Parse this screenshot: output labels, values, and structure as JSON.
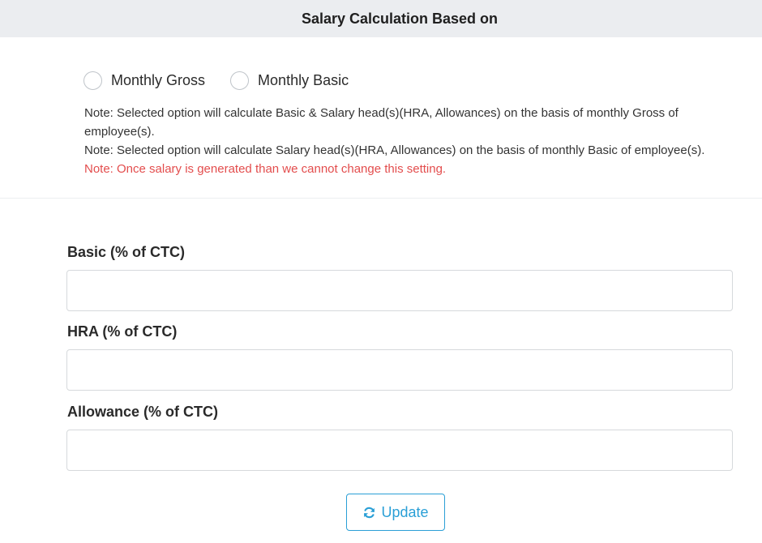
{
  "header": {
    "title": "Salary Calculation Based on"
  },
  "calculation_options": [
    {
      "label": "Monthly Gross",
      "selected": false
    },
    {
      "label": "Monthly Basic",
      "selected": false
    }
  ],
  "notes": {
    "gross_note": "Note: Selected option will calculate Basic & Salary head(s)(HRA, Allowances) on the basis of monthly Gross of employee(s).",
    "basic_note": "Note: Selected option will calculate Salary head(s)(HRA, Allowances) on the basis of monthly Basic of employee(s).",
    "warning_note": "Note: Once salary is generated than we cannot change this setting."
  },
  "fields": {
    "basic": {
      "label": "Basic (% of CTC)",
      "value": ""
    },
    "hra": {
      "label": "HRA (% of CTC)",
      "value": ""
    },
    "allowance": {
      "label": "Allowance (% of CTC)",
      "value": ""
    }
  },
  "actions": {
    "update_label": "Update",
    "update_icon": "refresh-icon"
  },
  "colors": {
    "header_bg": "#ebedf0",
    "accent": "#2a9fd6",
    "warning": "#e34d4d"
  }
}
